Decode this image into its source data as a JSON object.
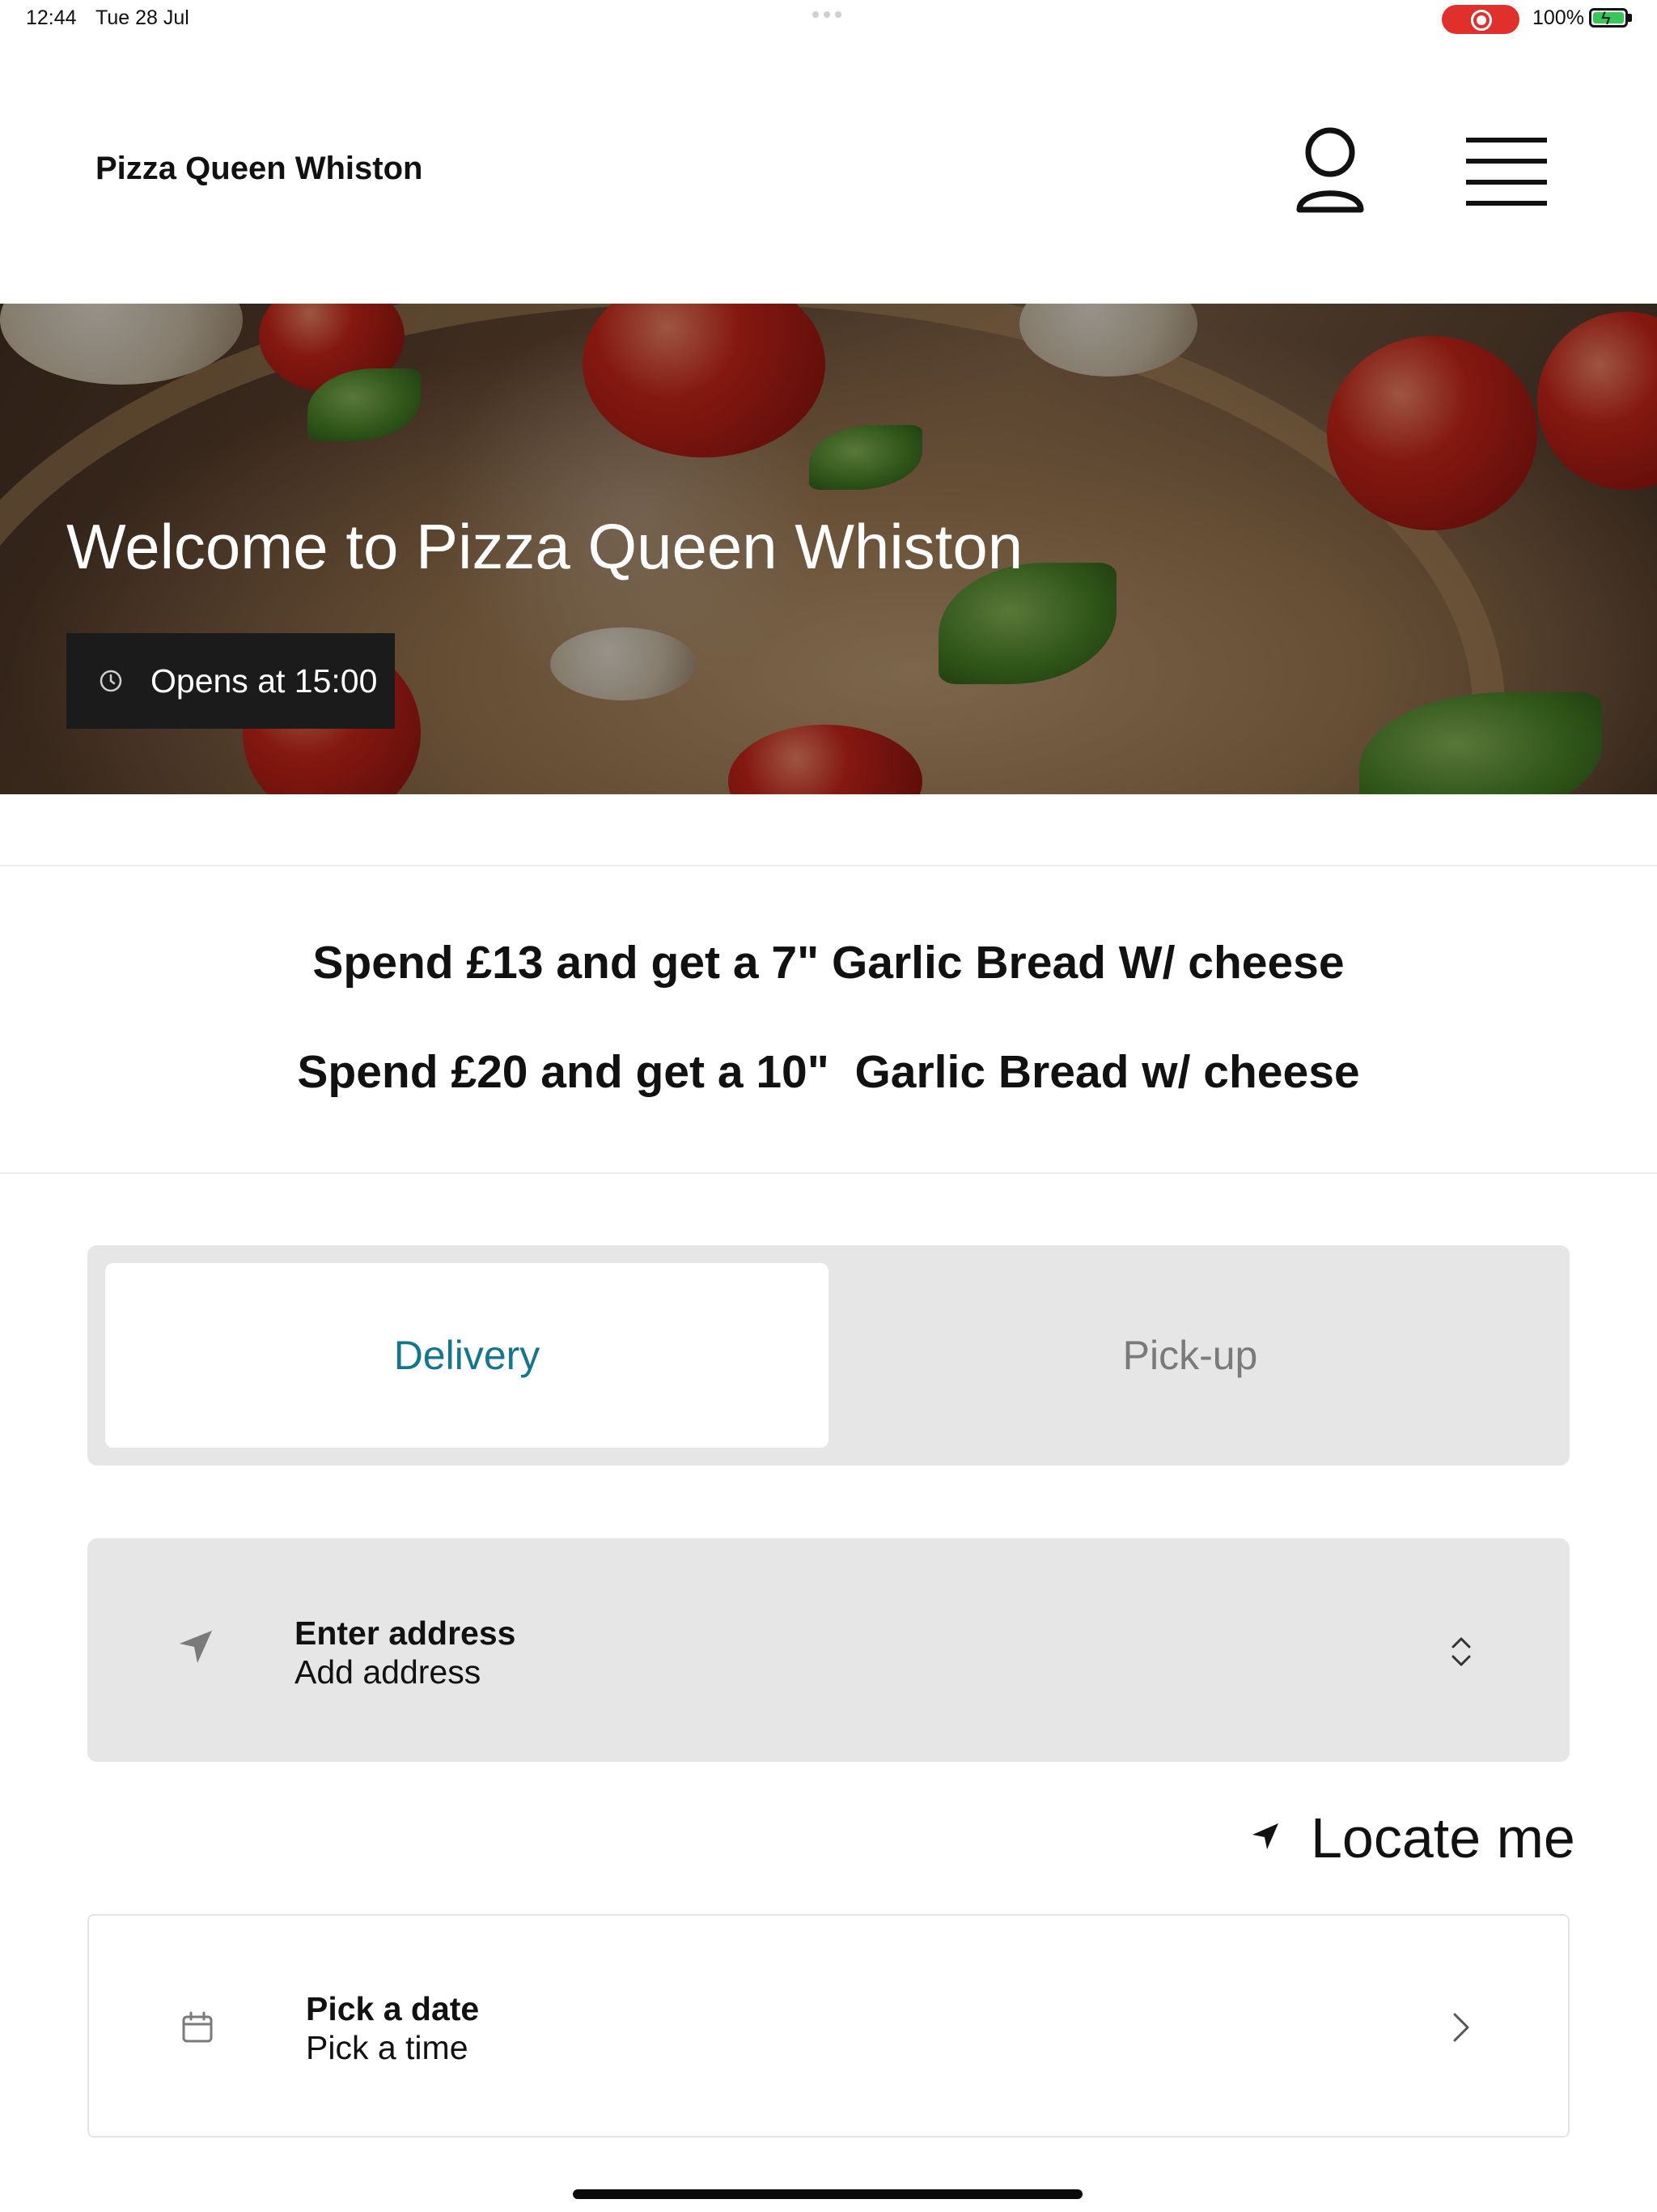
{
  "status_bar": {
    "time": "12:44",
    "date": "Tue 28 Jul",
    "battery": "100%",
    "recording_icon": "screen-record-icon",
    "battery_icon": "battery-charging-icon"
  },
  "header": {
    "brand": "Pizza Queen Whiston",
    "account_icon": "user-icon",
    "menu_icon": "hamburger-menu-icon"
  },
  "hero": {
    "title": "Welcome to Pizza Queen Whiston",
    "opening": "Opens at 15:00",
    "clock_icon": "clock-icon"
  },
  "promos": [
    "Spend £13 and get a 7\" Garlic Bread W/ cheese",
    "Spend £20 and get a 10\"  Garlic Bread w/ cheese"
  ],
  "order_mode": {
    "tabs": [
      "Delivery",
      "Pick-up"
    ],
    "selected": "Delivery"
  },
  "address": {
    "title": "Enter address",
    "subtitle": "Add address",
    "icon": "location-arrow-icon",
    "expand_icon": "chevron-up-down-icon"
  },
  "locate_me": {
    "label": "Locate me",
    "icon": "location-arrow-icon"
  },
  "schedule": {
    "title": "Pick a date",
    "subtitle": "Pick a time",
    "icon": "calendar-icon",
    "chevron_icon": "chevron-right-icon"
  },
  "colors": {
    "accent": "#15758d",
    "inactive_tab": "#7a7a7a",
    "panel": "#e6e6e6",
    "badge": "#1b1b1b",
    "record": "#e0302b",
    "battery": "#37c759"
  }
}
